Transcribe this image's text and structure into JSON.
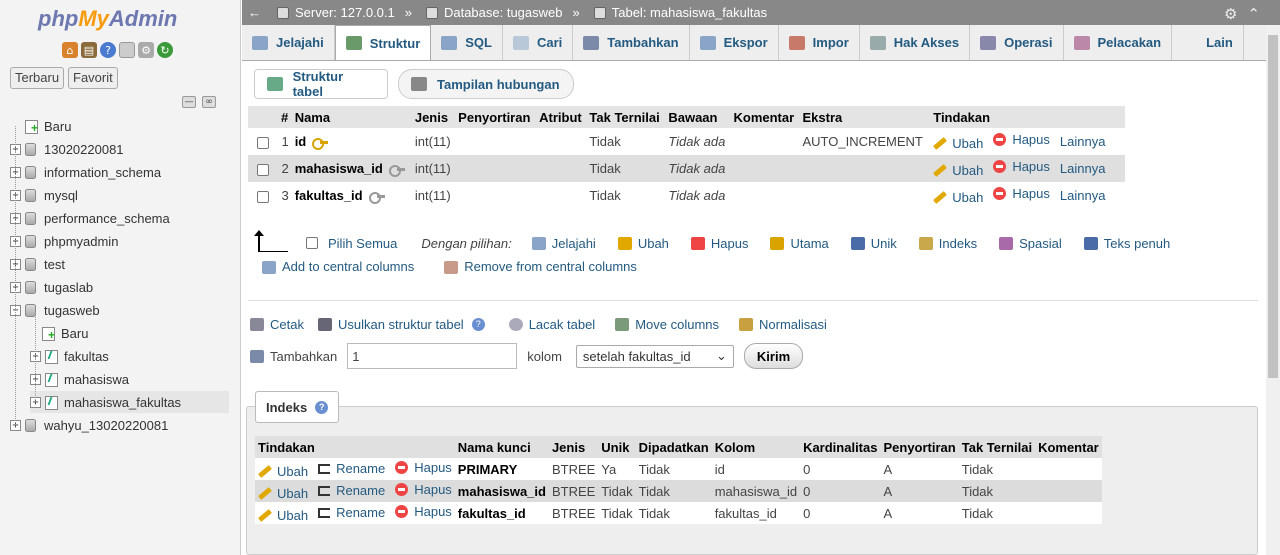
{
  "sidebar": {
    "logo": {
      "php": "php",
      "my": "My",
      "admin": "Admin"
    },
    "recent_btn": "Terbaru",
    "fav_btn": "Favorit",
    "tree": [
      {
        "label": "Baru",
        "type": "new",
        "level": 0
      },
      {
        "label": "13020220081",
        "type": "db",
        "level": 0
      },
      {
        "label": "information_schema",
        "type": "db",
        "level": 0
      },
      {
        "label": "mysql",
        "type": "db",
        "level": 0
      },
      {
        "label": "performance_schema",
        "type": "db",
        "level": 0
      },
      {
        "label": "phpmyadmin",
        "type": "db",
        "level": 0
      },
      {
        "label": "test",
        "type": "db",
        "level": 0
      },
      {
        "label": "tugaslab",
        "type": "db",
        "level": 0
      },
      {
        "label": "tugasweb",
        "type": "db",
        "level": 0,
        "expanded": true
      },
      {
        "label": "Baru",
        "type": "new",
        "level": 1
      },
      {
        "label": "fakultas",
        "type": "table",
        "level": 1
      },
      {
        "label": "mahasiswa",
        "type": "table",
        "level": 1
      },
      {
        "label": "mahasiswa_fakultas",
        "type": "table",
        "level": 1,
        "selected": true
      },
      {
        "label": "wahyu_13020220081",
        "type": "db",
        "level": 0
      }
    ]
  },
  "breadcrumb": {
    "server": "Server: 127.0.0.1",
    "database": "Database: tugasweb",
    "table": "Tabel: mahasiswa_fakultas",
    "sep": "»"
  },
  "tabs": [
    {
      "label": "Jelajahi",
      "icon": "browse-icon",
      "color": "#8aa4c8"
    },
    {
      "label": "Struktur",
      "icon": "structure-icon",
      "color": "#6a9a6a",
      "active": true
    },
    {
      "label": "SQL",
      "icon": "sql-icon",
      "color": "#8aa4c8"
    },
    {
      "label": "Cari",
      "icon": "search-icon",
      "color": "#b8c8d8"
    },
    {
      "label": "Tambahkan",
      "icon": "insert-icon",
      "color": "#7a8aa8"
    },
    {
      "label": "Ekspor",
      "icon": "export-icon",
      "color": "#8aa4c8"
    },
    {
      "label": "Impor",
      "icon": "import-icon",
      "color": "#c87a6a"
    },
    {
      "label": "Hak Akses",
      "icon": "privileges-icon",
      "color": "#9aa"
    },
    {
      "label": "Operasi",
      "icon": "wrench-icon",
      "color": "#88a"
    },
    {
      "label": "Pelacakan",
      "icon": "eye-icon",
      "color": "#b8a"
    },
    {
      "label": "Lain",
      "icon": "chevron-down-icon",
      "color": "#eee"
    }
  ],
  "subtabs": {
    "structure": "Struktur tabel",
    "relation": "Tampilan hubungan"
  },
  "structure_table": {
    "headers": [
      "#",
      "Nama",
      "Jenis",
      "Penyortiran",
      "Atribut",
      "Tak Ternilai",
      "Bawaan",
      "Komentar",
      "Ekstra",
      "Tindakan"
    ],
    "rows": [
      {
        "num": "1",
        "name": "id",
        "type": "int(11)",
        "collation": "",
        "attr": "",
        "null": "Tidak",
        "default": "Tidak ada",
        "comment": "",
        "extra": "AUTO_INCREMENT",
        "key": "primary"
      },
      {
        "num": "2",
        "name": "mahasiswa_id",
        "type": "int(11)",
        "collation": "",
        "attr": "",
        "null": "Tidak",
        "default": "Tidak ada",
        "comment": "",
        "extra": "",
        "key": "index"
      },
      {
        "num": "3",
        "name": "fakultas_id",
        "type": "int(11)",
        "collation": "",
        "attr": "",
        "null": "Tidak",
        "default": "Tidak ada",
        "comment": "",
        "extra": "",
        "key": "index"
      }
    ],
    "actions": {
      "edit": "Ubah",
      "drop": "Hapus",
      "more": "Lainnya"
    }
  },
  "bulk": {
    "select_all": "Pilih Semua",
    "with_selected": "Dengan pilihan:",
    "items": [
      {
        "label": "Jelajahi",
        "color": "#8aa4c8"
      },
      {
        "label": "Ubah",
        "color": "#e0a800"
      },
      {
        "label": "Hapus",
        "color": "#e44"
      },
      {
        "label": "Utama",
        "color": "#d9a400"
      },
      {
        "label": "Unik",
        "color": "#4a6aa8"
      },
      {
        "label": "Indeks",
        "color": "#c8a84a"
      },
      {
        "label": "Spasial",
        "color": "#a86aa8"
      },
      {
        "label": "Teks penuh",
        "color": "#4a6aa8"
      }
    ],
    "add_central": "Add to central columns",
    "remove_central": "Remove from central columns"
  },
  "tools": {
    "print": "Cetak",
    "propose": "Usulkan struktur tabel",
    "track": "Lacak tabel",
    "move": "Move columns",
    "normalize": "Normalisasi"
  },
  "add_column": {
    "label": "Tambahkan",
    "count": "1",
    "unit": "kolom",
    "position": "setelah fakultas_id",
    "submit": "Kirim"
  },
  "indexes": {
    "title": "Indeks",
    "headers": [
      "Tindakan",
      "Nama kunci",
      "Jenis",
      "Unik",
      "Dipadatkan",
      "Kolom",
      "Kardinalitas",
      "Penyortiran",
      "Tak Ternilai",
      "Komentar"
    ],
    "rows": [
      {
        "name": "PRIMARY",
        "type": "BTREE",
        "unique": "Ya",
        "packed": "Tidak",
        "column": "id",
        "cardinality": "0",
        "collation": "A",
        "null": "Tidak",
        "comment": ""
      },
      {
        "name": "mahasiswa_id",
        "type": "BTREE",
        "unique": "Tidak",
        "packed": "Tidak",
        "column": "mahasiswa_id",
        "cardinality": "0",
        "collation": "A",
        "null": "Tidak",
        "comment": ""
      },
      {
        "name": "fakultas_id",
        "type": "BTREE",
        "unique": "Tidak",
        "packed": "Tidak",
        "column": "fakultas_id",
        "cardinality": "0",
        "collation": "A",
        "null": "Tidak",
        "comment": ""
      }
    ],
    "actions": {
      "edit": "Ubah",
      "rename": "Rename",
      "drop": "Hapus"
    }
  }
}
